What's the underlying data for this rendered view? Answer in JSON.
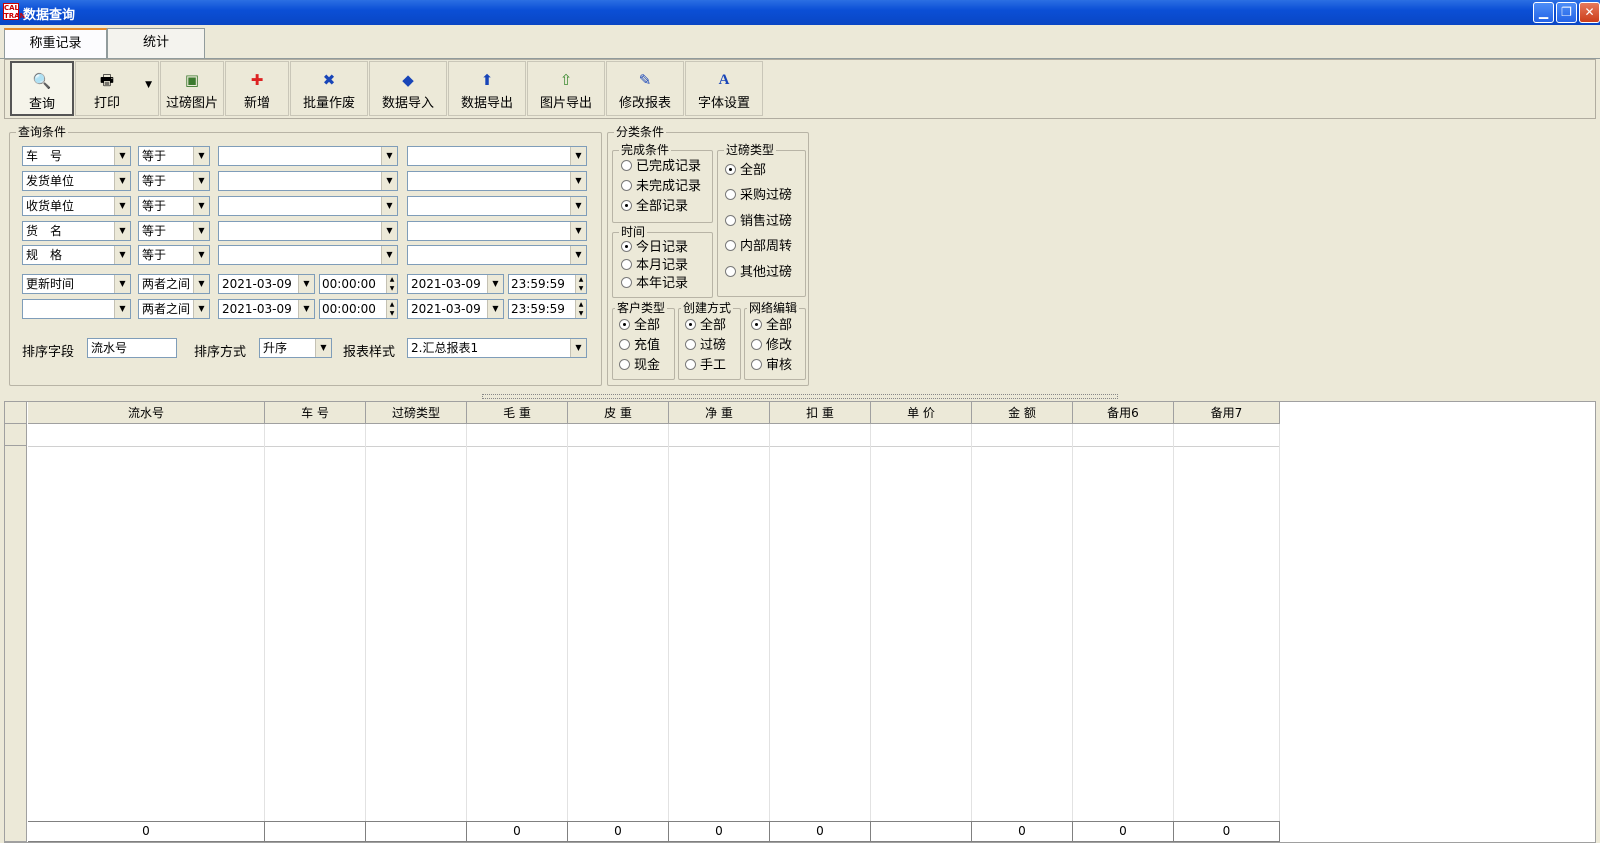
{
  "window": {
    "title": "数据查询",
    "icon_text": "CAL TRAN"
  },
  "tabs": [
    {
      "label": "称重记录",
      "active": true
    },
    {
      "label": "统计",
      "active": false
    }
  ],
  "toolbar": [
    {
      "label": "查询",
      "icon": "search-icon"
    },
    {
      "label": "打印",
      "icon": "printer-icon"
    },
    {
      "label": "过磅图片",
      "icon": "image-icon"
    },
    {
      "label": "新增",
      "icon": "plus-icon"
    },
    {
      "label": "批量作废",
      "icon": "x-icon"
    },
    {
      "label": "数据导入",
      "icon": "import-icon"
    },
    {
      "label": "数据导出",
      "icon": "export-icon"
    },
    {
      "label": "图片导出",
      "icon": "image-export-icon"
    },
    {
      "label": "修改报表",
      "icon": "pen-icon"
    },
    {
      "label": "字体设置",
      "icon": "font-icon"
    }
  ],
  "query": {
    "legend": "查询条件",
    "rows": [
      {
        "field": "车　号",
        "op": "等于",
        "v1": "",
        "v2": ""
      },
      {
        "field": "发货单位",
        "op": "等于",
        "v1": "",
        "v2": ""
      },
      {
        "field": "收货单位",
        "op": "等于",
        "v1": "",
        "v2": ""
      },
      {
        "field": "货　名",
        "op": "等于",
        "v1": "",
        "v2": ""
      },
      {
        "field": "规　格",
        "op": "等于",
        "v1": "",
        "v2": ""
      }
    ],
    "time_rows": [
      {
        "field": "更新时间",
        "op": "两者之间",
        "d1": "2021-03-09",
        "t1": "00:00:00",
        "d2": "2021-03-09",
        "t2": "23:59:59"
      },
      {
        "field": "",
        "op": "两者之间",
        "d1": "2021-03-09",
        "t1": "00:00:00",
        "d2": "2021-03-09",
        "t2": "23:59:59"
      }
    ],
    "sort_field_label": "排序字段",
    "sort_field_value": "流水号",
    "sort_mode_label": "排序方式",
    "sort_mode_value": "升序",
    "report_style_label": "报表样式",
    "report_style_value": "2.汇总报表1"
  },
  "classify": {
    "legend": "分类条件",
    "completion": {
      "legend": "完成条件",
      "options": [
        "已完成记录",
        "未完成记录",
        "全部记录"
      ],
      "selected": 2
    },
    "time": {
      "legend": "时间",
      "options": [
        "今日记录",
        "本月记录",
        "本年记录"
      ],
      "selected": 0
    },
    "weigh_type": {
      "legend": "过磅类型",
      "options": [
        "全部",
        "采购过磅",
        "销售过磅",
        "内部周转",
        "其他过磅"
      ],
      "selected": 0
    },
    "customer_type": {
      "legend": "客户类型",
      "options": [
        "全部",
        "充值",
        "现金"
      ],
      "selected": 0
    },
    "create_mode": {
      "legend": "创建方式",
      "options": [
        "全部",
        "过磅",
        "手工"
      ],
      "selected": 0
    },
    "network_edit": {
      "legend": "网络编辑",
      "options": [
        "全部",
        "修改",
        "审核"
      ],
      "selected": 0
    }
  },
  "grid": {
    "columns": [
      "流水号",
      "车 号",
      "过磅类型",
      "毛 重",
      "皮 重",
      "净 重",
      "扣 重",
      "单 价",
      "金 额",
      "备用6",
      "备用7"
    ],
    "footer": [
      "0",
      "",
      "",
      "0",
      "0",
      "0",
      "0",
      "",
      "0",
      "0",
      "0"
    ]
  }
}
